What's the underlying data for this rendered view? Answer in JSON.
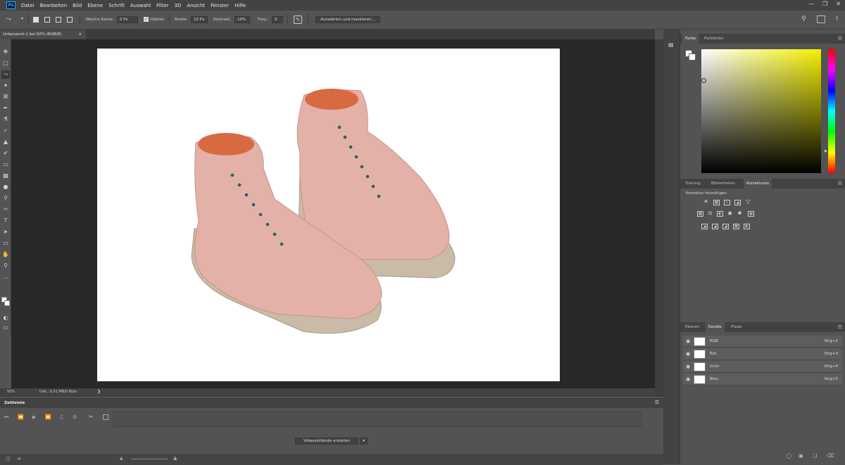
{
  "app": {
    "logo": "Ps"
  },
  "menu": [
    "Datei",
    "Bearbeiten",
    "Bild",
    "Ebene",
    "Schrift",
    "Auswahl",
    "Filter",
    "3D",
    "Ansicht",
    "Fenster",
    "Hilfe"
  ],
  "options": {
    "feather_label": "Weiche Kante:",
    "feather_value": "0 Px",
    "antialias_label": "Glätten",
    "width_label": "Breite:",
    "width_value": "10 Px",
    "contrast_label": "Kontrast:",
    "contrast_value": "10%",
    "frequency_label": "Freq.:",
    "frequency_value": "0",
    "select_mask_button": "Auswählen und maskieren..."
  },
  "document": {
    "tab_title": "Unbenannt-1 bei 50% (RGB/8)"
  },
  "status": {
    "zoom": "50%",
    "doc_info": "Dok.: 9,01 MB/0 Byte"
  },
  "timeline": {
    "title": "Zeitleiste",
    "create_button": "Videozeitleiste erstellen"
  },
  "color_panel": {
    "tabs": [
      "Farbe",
      "Farbfelder"
    ],
    "active_tab": "Farbe"
  },
  "adjustments_panel": {
    "tabs": [
      "Training",
      "Bibliotheken",
      "Korrekturen"
    ],
    "active_tab": "Korrekturen",
    "heading": "Korrektur hinzufügen"
  },
  "layers_panel": {
    "tabs": [
      "Ebenen",
      "Kanäle",
      "Pfade"
    ],
    "active_tab": "Kanäle",
    "channels": [
      {
        "name": "RGB",
        "shortcut": "Strg+2"
      },
      {
        "name": "Rot",
        "shortcut": "Strg+3"
      },
      {
        "name": "Grün",
        "shortcut": "Strg+4"
      },
      {
        "name": "Blau",
        "shortcut": "Strg+5"
      }
    ]
  },
  "colors": {
    "boot_pink": "#e3b1a8",
    "sole": "#c9bba7",
    "collar": "#d86a42"
  }
}
